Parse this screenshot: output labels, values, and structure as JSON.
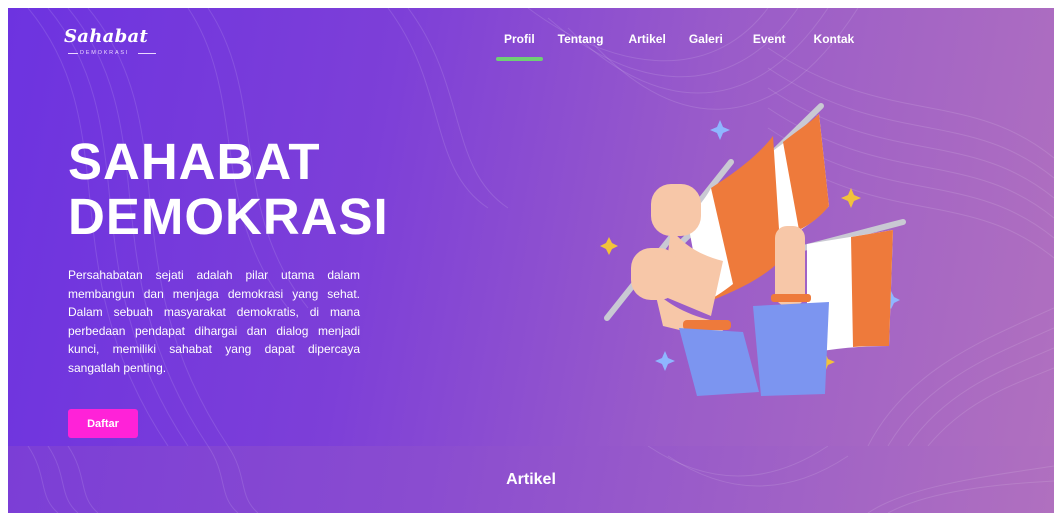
{
  "brand": {
    "name": "Sahabat",
    "tagline": "DEMOKRASI"
  },
  "nav": {
    "items": [
      {
        "label": "Profil",
        "active": true
      },
      {
        "label": "Tentang",
        "active": false
      },
      {
        "label": "Artikel",
        "active": false
      },
      {
        "label": "Galeri",
        "active": false
      },
      {
        "label": "Event",
        "active": false
      },
      {
        "label": "Kontak",
        "active": false
      }
    ]
  },
  "hero": {
    "title_line1": "SAHABAT",
    "title_line2": "DEMOKRASI",
    "description": "Persahabatan sejati adalah pilar utama dalam membangun dan menjaga demokrasi yang sehat. Dalam sebuah masyarakat demokratis, di mana perbedaan pendapat dihargai dan dialog menjadi kunci, memiliki sahabat yang dapat dipercaya sangatlah penting.",
    "cta_label": "Daftar"
  },
  "section": {
    "title": "Artikel"
  },
  "colors": {
    "hero_gradient_start": "#6d33e0",
    "hero_gradient_end": "#b070bf",
    "cta_background": "#ff22d8",
    "nav_active_underline": "#6fcf75",
    "flag_orange": "#ee7a3b",
    "flag_white": "#ffffff"
  },
  "icons": {
    "illustration": "hands-holding-flags-illustration"
  }
}
